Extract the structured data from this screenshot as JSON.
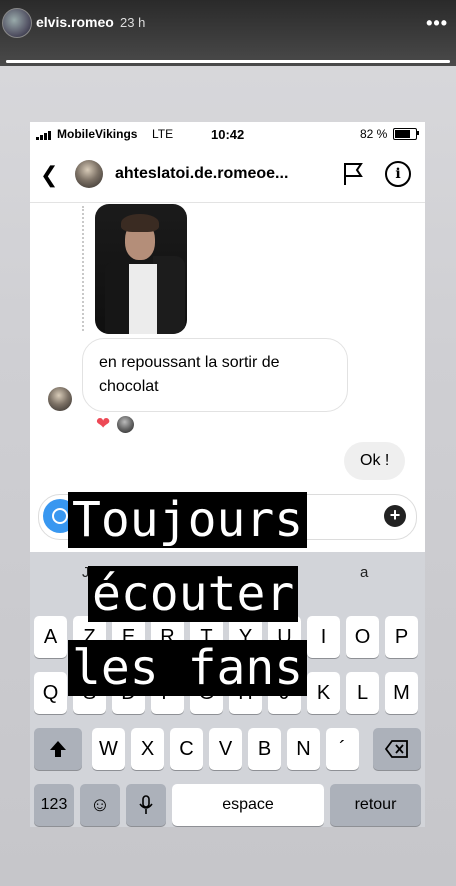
{
  "story": {
    "username": "elvis.romeo",
    "time_ago": "23 h",
    "menu_icon": "more-dots-icon",
    "progress": 1.0
  },
  "phone_status": {
    "carrier": "MobileVikings",
    "network": "LTE",
    "time": "10:42",
    "battery": "82 %",
    "battery_level": 0.82
  },
  "chat": {
    "back_icon": "chevron-left-icon",
    "title": "ahteslatoi.de.romeoe...",
    "flag_icon": "flag-icon",
    "info_icon": "info-icon",
    "messages": [
      {
        "type": "image",
        "from": "them"
      },
      {
        "type": "text",
        "from": "them",
        "text": "en repoussant la sortir de chocolat"
      },
      {
        "type": "text",
        "from": "me",
        "text": "Ok !"
      }
    ],
    "reaction_icon": "heart-icon"
  },
  "composer": {
    "camera_icon": "camera-icon",
    "placeholder": "",
    "plus_icon": "plus-icon"
  },
  "keyboard": {
    "suggestions": [
      "J",
      "a"
    ],
    "row1": [
      "A",
      "Z",
      "E",
      "R",
      "T",
      "Y",
      "U",
      "I",
      "O",
      "P"
    ],
    "row2": [
      "Q",
      "S",
      "D",
      "F",
      "G",
      "H",
      "J",
      "K",
      "L",
      "M"
    ],
    "row3": [
      "W",
      "X",
      "C",
      "V",
      "B",
      "N",
      "´"
    ],
    "shift_icon": "shift-icon",
    "delete_icon": "backspace-icon",
    "numbers_label": "123",
    "emoji_icon": "emoji-icon",
    "mic_icon": "microphone-icon",
    "space_label": "espace",
    "return_label": "retour"
  },
  "overlay_text": {
    "line1": "Toujours",
    "line2": "écouter",
    "line3": "les fans"
  }
}
